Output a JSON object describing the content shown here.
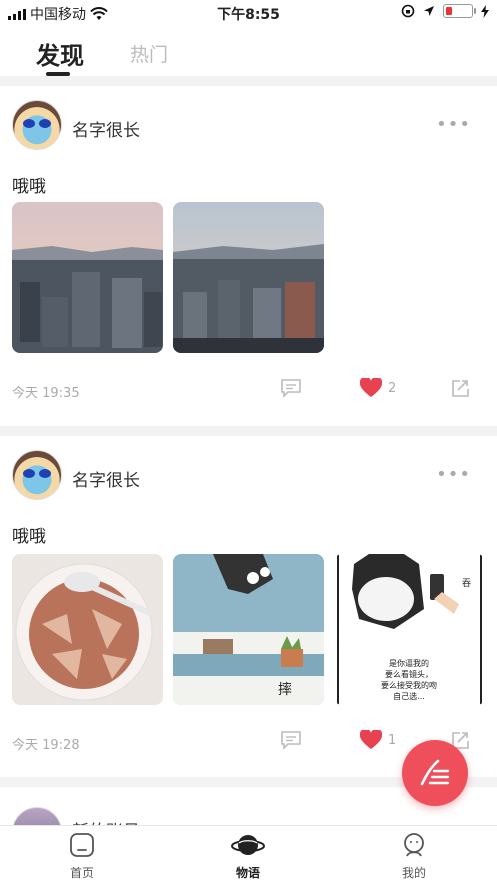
{
  "status_bar": {
    "carrier": "中国移动",
    "time": "下午8:55"
  },
  "tabs": {
    "active": "发现",
    "inactive": "热门"
  },
  "posts": [
    {
      "username": "名字很长",
      "text": "哦哦",
      "time": "今天 19:35",
      "likes": "2"
    },
    {
      "username": "名字很长",
      "text": "哦哦",
      "time": "今天 19:28",
      "likes": "1"
    }
  ],
  "partial_post": {
    "username": "新的账号"
  },
  "comic": {
    "side_char": "吞",
    "caption_line1": "是你逼我的",
    "caption_line2": "要么看镜头，",
    "caption_line3": "要么接受我的吻",
    "caption_line4": "自己选...",
    "sign": "摔"
  },
  "nav": {
    "home": "首页",
    "stories": "物语",
    "mine": "我的"
  },
  "colors": {
    "accent": "#ef4f5a",
    "heart": "#e8414f"
  },
  "icons": {
    "more": "more-dots-icon",
    "comment": "comment-icon",
    "like": "heart-icon",
    "share": "share-icon",
    "fab": "write-icon"
  }
}
